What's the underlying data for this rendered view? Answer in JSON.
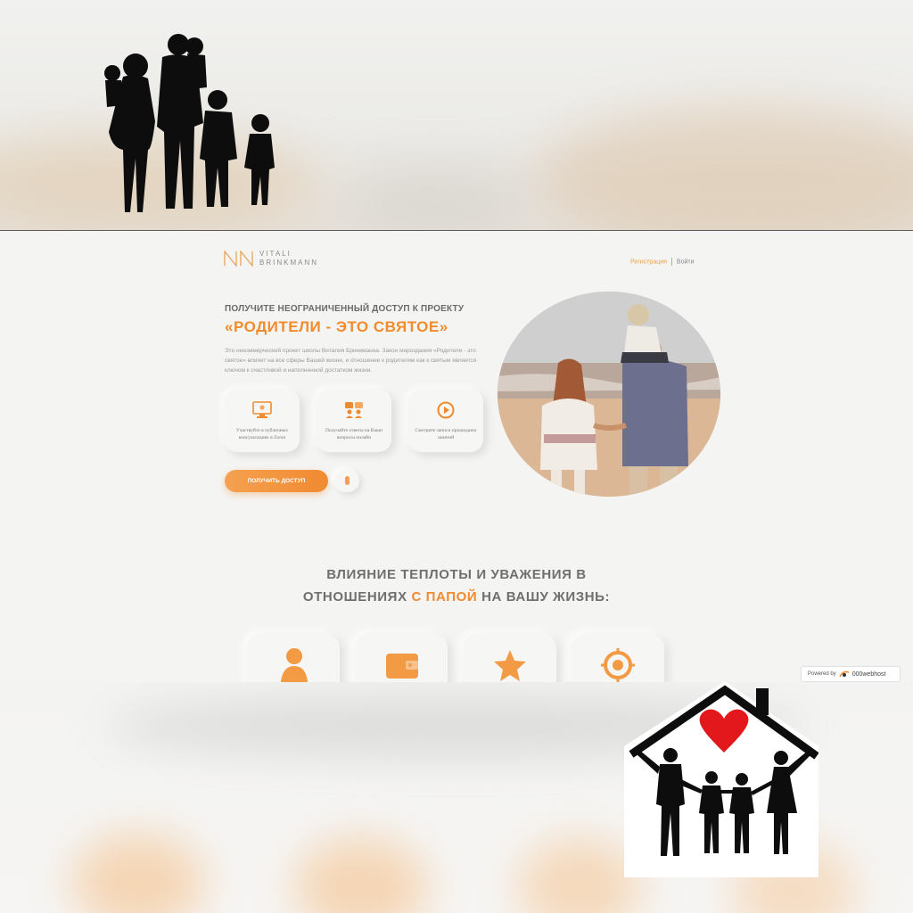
{
  "logo": {
    "line1": "VITALI",
    "line2": "BRINKMANN"
  },
  "nav": {
    "register": "Регистрация",
    "login": "Войти"
  },
  "hero": {
    "pre_title": "ПОЛУЧИТЕ НЕОГРАНИЧЕННЫЙ ДОСТУП К ПРОЕКТУ",
    "title": "«РОДИТЕЛИ - ЭТО СВЯТОЕ»",
    "description": "Это некоммерческий проект школы Виталия Бринкманна. Закон мироздания «Родители - это святое» влияет на все сферы Вашей жизни, и отношение к родителям как к святым является ключом к счастливой и наполненной достатком жизни."
  },
  "features": [
    {
      "icon": "monitor-icon",
      "text": "Участвуйте в публичных консультациях в Zoom"
    },
    {
      "icon": "chat-people-icon",
      "text": "Получайте ответы на Ваши вопросы онлайн"
    },
    {
      "icon": "play-icon",
      "text": "Смотрите записи прошедших занятий"
    }
  ],
  "cta": {
    "label": "ПОЛУЧИТЬ ДОСТУП"
  },
  "section": {
    "line1": "ВЛИЯНИЕ ТЕПЛОТЫ И УВАЖЕНИЯ В",
    "line2_before": "ОТНОШЕНИЯХ ",
    "line2_accent": "С ПАПОЙ",
    "line2_after": " НА ВАШУ ЖИЗНЬ:"
  },
  "cards": [
    {
      "icon": "person-icon"
    },
    {
      "icon": "wallet-icon"
    },
    {
      "icon": "star-icon"
    },
    {
      "icon": "target-icon"
    }
  ],
  "badge": {
    "prefix": "Powered by",
    "brand": "000webhost"
  },
  "colors": {
    "accent": "#f08a30",
    "text": "#6f6f6f",
    "background": "#f4f4f3"
  }
}
